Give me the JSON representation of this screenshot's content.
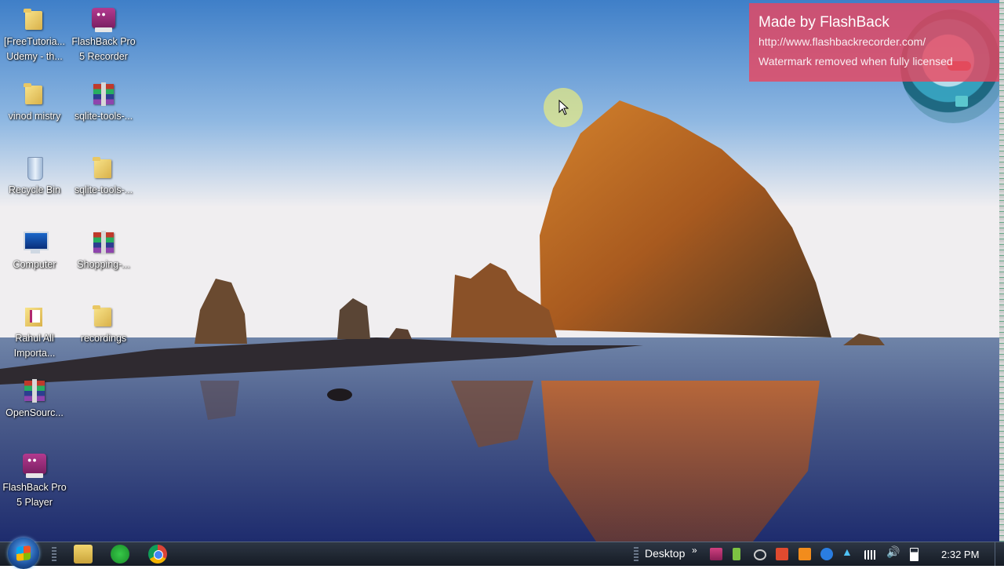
{
  "desktop": {
    "icons": [
      {
        "label": "[FreeTutoria...\nUdemy - th...",
        "kind": "folder"
      },
      {
        "label": "FlashBack Pro\n5 Recorder",
        "kind": "flashback"
      },
      {
        "label": "vinod mistry",
        "kind": "folder"
      },
      {
        "label": "sqlite-tools-...",
        "kind": "rar"
      },
      {
        "label": "Recycle Bin",
        "kind": "recycle-bin"
      },
      {
        "label": "sqlite-tools-...",
        "kind": "folder"
      },
      {
        "label": "Computer",
        "kind": "computer"
      },
      {
        "label": "Shopping-...",
        "kind": "rar"
      },
      {
        "label": "Rahul All\nImporta...",
        "kind": "document-folder"
      },
      {
        "label": "recordings",
        "kind": "folder"
      },
      {
        "label": "OpenSourc...",
        "kind": "rar"
      },
      {
        "label": "FlashBack Pro\n5 Player",
        "kind": "flashback"
      }
    ]
  },
  "watermark": {
    "title": "Made by FlashBack",
    "url": "http://www.flashbackrecorder.com/",
    "note": "Watermark removed when fully licensed"
  },
  "taskbar": {
    "pinned": [
      "start-orb",
      "windows-explorer",
      "green-app",
      "chrome"
    ],
    "desktop_label": "Desktop",
    "overflow_chevron": "»",
    "clock": "2:32 PM",
    "tray_icons": [
      "flashback-tray",
      "battery-app",
      "sync",
      "red-app",
      "orange-app",
      "blue-app",
      "a-icon",
      "network-bars",
      "volume",
      "battery"
    ]
  },
  "colors": {
    "watermark_bg": "#e84760",
    "taskbar_bg": "#1e2530"
  }
}
